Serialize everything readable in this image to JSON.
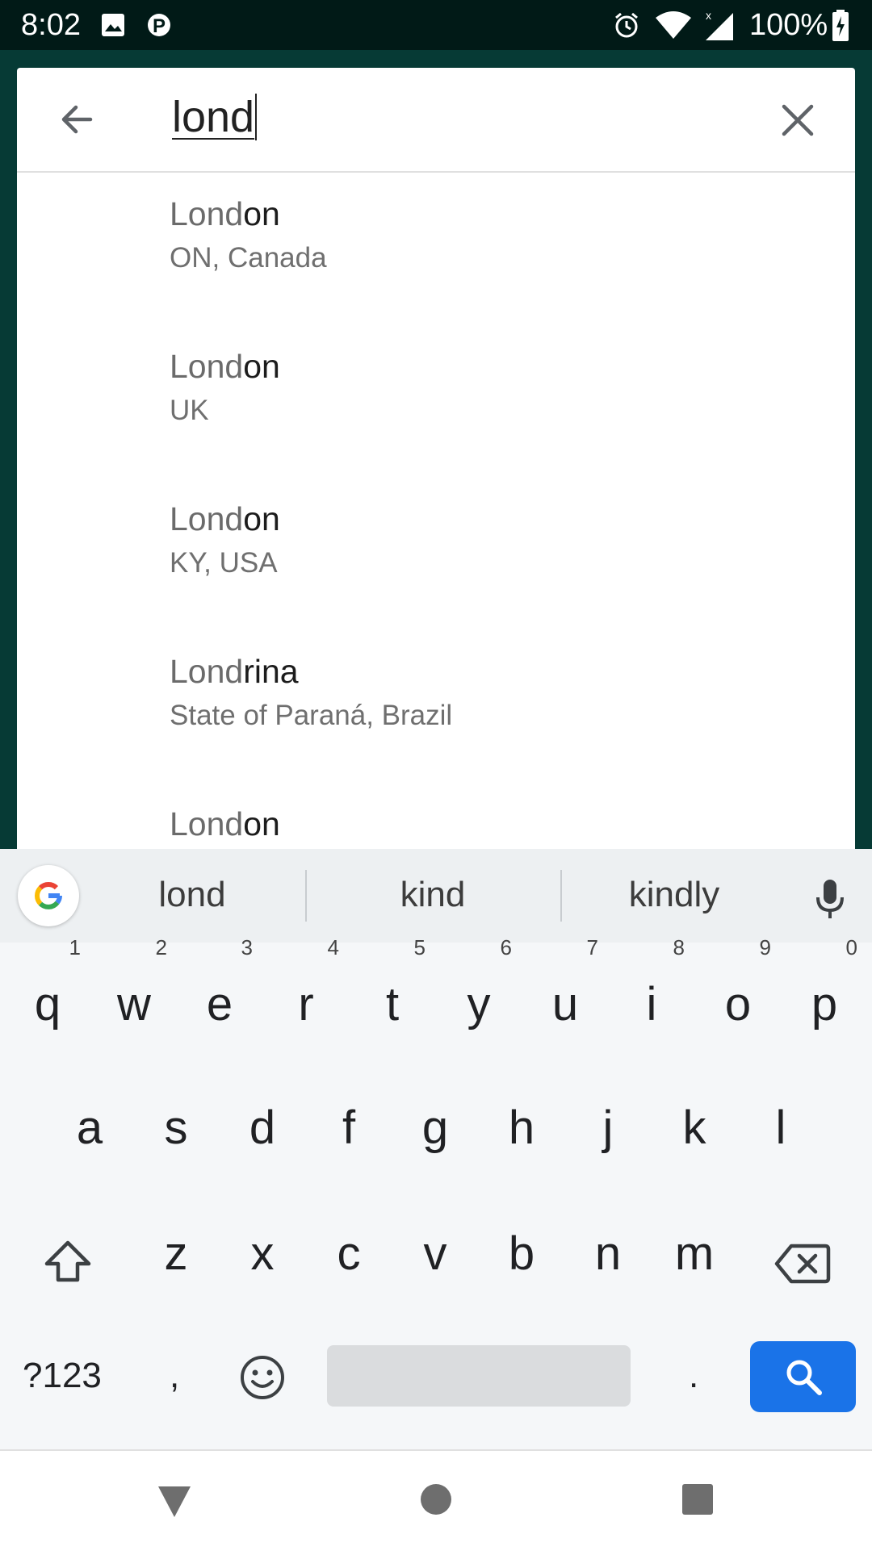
{
  "status_bar": {
    "time": "8:02",
    "battery": "100%",
    "icons": [
      "image-icon",
      "parking-icon",
      "alarm-icon",
      "wifi-icon",
      "signal-icon",
      "battery-charging-icon"
    ]
  },
  "search": {
    "query": "lond",
    "back_icon": "arrow-back-icon",
    "clear_icon": "close-icon"
  },
  "results": [
    {
      "match": "Lond",
      "rest": "on",
      "sub": "ON, Canada"
    },
    {
      "match": "Lond",
      "rest": "on",
      "sub": "UK"
    },
    {
      "match": "Lond",
      "rest": "on",
      "sub": "KY, USA"
    },
    {
      "match": "Lond",
      "rest": "rina",
      "sub": "State of Paraná, Brazil"
    },
    {
      "match": "Lond",
      "rest": "on",
      "sub": ""
    }
  ],
  "keyboard": {
    "suggestions": [
      "lond",
      "kind",
      "kindly"
    ],
    "row1": [
      {
        "key": "q",
        "hint": "1"
      },
      {
        "key": "w",
        "hint": "2"
      },
      {
        "key": "e",
        "hint": "3"
      },
      {
        "key": "r",
        "hint": "4"
      },
      {
        "key": "t",
        "hint": "5"
      },
      {
        "key": "y",
        "hint": "6"
      },
      {
        "key": "u",
        "hint": "7"
      },
      {
        "key": "i",
        "hint": "8"
      },
      {
        "key": "o",
        "hint": "9"
      },
      {
        "key": "p",
        "hint": "0"
      }
    ],
    "row2": [
      "a",
      "s",
      "d",
      "f",
      "g",
      "h",
      "j",
      "k",
      "l"
    ],
    "row3": [
      "z",
      "x",
      "c",
      "v",
      "b",
      "n",
      "m"
    ],
    "symbols_label": "?123",
    "comma": ",",
    "period": ".",
    "accent_color": "#1a73e8"
  },
  "nav": {
    "icons": [
      "back-triangle-icon",
      "home-circle-icon",
      "recents-square-icon"
    ]
  }
}
